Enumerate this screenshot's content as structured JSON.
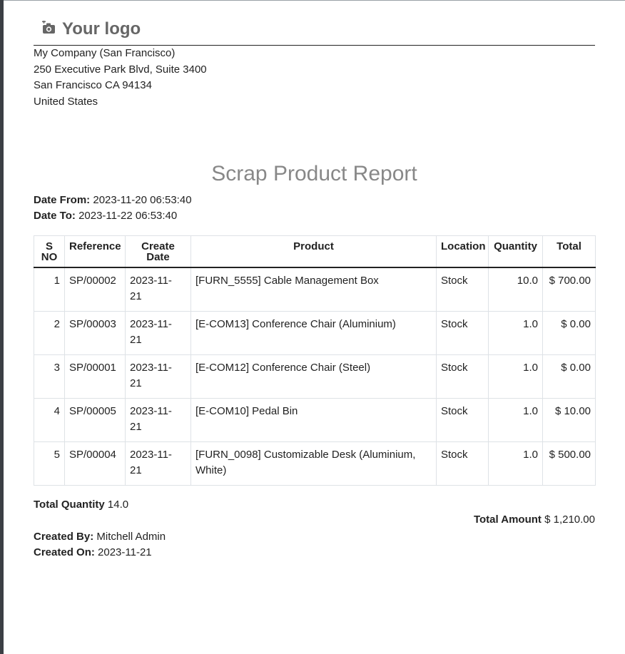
{
  "logo": {
    "text": "Your logo"
  },
  "company": {
    "name": "My Company (San Francisco)",
    "street": "250 Executive Park Blvd, Suite 3400",
    "city": "San Francisco CA 94134",
    "country": "United States"
  },
  "report": {
    "title": "Scrap Product Report",
    "date_from_label": "Date From:",
    "date_from": "2023-11-20 06:53:40",
    "date_to_label": "Date To:",
    "date_to": "2023-11-22 06:53:40"
  },
  "table": {
    "headers": {
      "sno_1": "S",
      "sno_2": "NO",
      "reference": "Reference",
      "create_date_1": "Create",
      "create_date_2": "Date",
      "product": "Product",
      "location": "Location",
      "quantity": "Quantity",
      "total": "Total"
    },
    "rows": [
      {
        "sno": "1",
        "reference": "SP/00002",
        "date_1": "2023-11-",
        "date_2": "21",
        "product": "[FURN_5555] Cable Management Box",
        "location": "Stock",
        "quantity": "10.0",
        "total": "$ 700.00"
      },
      {
        "sno": "2",
        "reference": "SP/00003",
        "date_1": "2023-11-",
        "date_2": "21",
        "product": "[E-COM13] Conference Chair (Aluminium)",
        "location": "Stock",
        "quantity": "1.0",
        "total": "$ 0.00"
      },
      {
        "sno": "3",
        "reference": "SP/00001",
        "date_1": "2023-11-",
        "date_2": "21",
        "product": "[E-COM12] Conference Chair (Steel)",
        "location": "Stock",
        "quantity": "1.0",
        "total": "$ 0.00"
      },
      {
        "sno": "4",
        "reference": "SP/00005",
        "date_1": "2023-11-",
        "date_2": "21",
        "product": "[E-COM10] Pedal Bin",
        "location": "Stock",
        "quantity": "1.0",
        "total": "$ 10.00"
      },
      {
        "sno": "5",
        "reference": "SP/00004",
        "date_1": "2023-11-",
        "date_2": "21",
        "product": "[FURN_0098] Customizable Desk (Aluminium, White)",
        "location": "Stock",
        "quantity": "1.0",
        "total": "$ 500.00"
      }
    ]
  },
  "summary": {
    "total_quantity_label": "Total Quantity",
    "total_quantity": "14.0",
    "total_amount_label": "Total Amount",
    "total_amount": "$ 1,210.00",
    "created_by_label": "Created By:",
    "created_by": "Mitchell Admin",
    "created_on_label": "Created On:",
    "created_on": "2023-11-21"
  }
}
